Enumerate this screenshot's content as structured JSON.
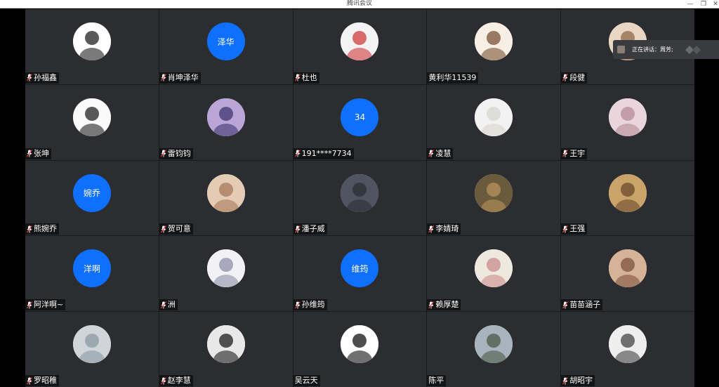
{
  "window": {
    "title": "腾讯会议",
    "minimize": "—",
    "maximize": "❐",
    "close": "✕"
  },
  "speaking": {
    "label": "正在讲话：周芳;"
  },
  "participants": [
    {
      "name": "孙福鑫",
      "avatar": "ok-hand-sticker-icon",
      "mic": true
    },
    {
      "name": "肖坤泽华",
      "avatar_text": "泽华",
      "mic": true
    },
    {
      "name": "杜也",
      "avatar": "santa-hat-character-icon",
      "mic": true
    },
    {
      "name": "黄利华11539",
      "avatar": "cartoon-boy-icon",
      "mic": false
    },
    {
      "name": "段健",
      "avatar": "plush-toy-icon",
      "mic": true
    },
    {
      "name": "张坤",
      "avatar": "manga-boy-icon",
      "mic": true
    },
    {
      "name": "雷钧钧",
      "avatar": "anime-character-icon",
      "mic": true
    },
    {
      "name": "191****7734",
      "avatar_text": "34",
      "mic": true
    },
    {
      "name": "凌慧",
      "avatar": "white-dog-icon",
      "mic": true
    },
    {
      "name": "王宇",
      "avatar": "pink-room-photo-icon",
      "mic": true
    },
    {
      "name": "熊婉乔",
      "avatar_text": "婉乔",
      "mic": true
    },
    {
      "name": "贺可意",
      "avatar": "child-photo-icon",
      "mic": true
    },
    {
      "name": "潘子威",
      "avatar": "dark-street-photo-icon",
      "mic": true
    },
    {
      "name": "李婧琦",
      "avatar": "teddy-bear-icon",
      "mic": true
    },
    {
      "name": "王强",
      "avatar": "sunset-person-icon",
      "mic": true
    },
    {
      "name": "阿洋啊~",
      "avatar_text": "洋啊",
      "mic": true
    },
    {
      "name": "洲",
      "avatar": "anime-silver-hair-icon",
      "mic": true
    },
    {
      "name": "孙维筠",
      "avatar_text": "维筠",
      "mic": true
    },
    {
      "name": "赖厚楚",
      "avatar": "sketch-drawing-icon",
      "mic": true
    },
    {
      "name": "苗苗涵子",
      "avatar": "baby-photo-icon",
      "mic": true
    },
    {
      "name": "罗昭稚",
      "avatar": "building-photo-icon",
      "mic": true
    },
    {
      "name": "赵李慧",
      "avatar": "long-hair-girl-icon",
      "mic": true
    },
    {
      "name": "吴云天",
      "avatar": "hollow-knight-icon",
      "mic": false
    },
    {
      "name": "陈平",
      "avatar": "landscape-photo-icon",
      "mic": false
    },
    {
      "name": "胡昭宇",
      "avatar": "grayscale-anime-icon",
      "mic": true
    }
  ],
  "colors": {
    "text_avatar_bg": "#0f6fff",
    "tile_bg": "#2c2d30",
    "mic_muted": "#e34040"
  }
}
